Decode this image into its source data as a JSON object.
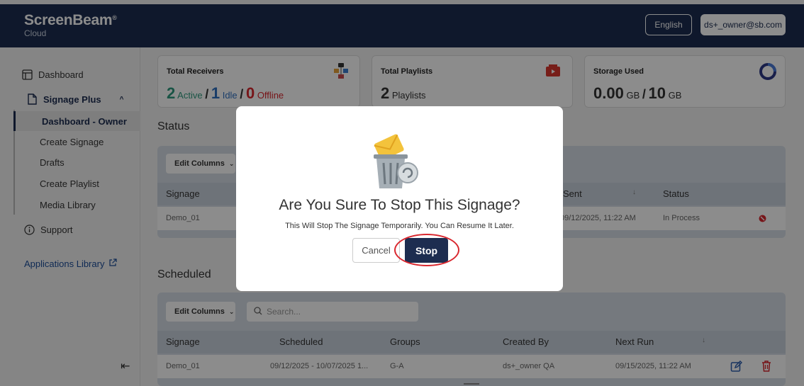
{
  "header": {
    "brand": "ScreenBeam",
    "brand_mark": "®",
    "sub": "Cloud",
    "language": "English",
    "user": "ds+_owner@sb.com"
  },
  "sidebar": {
    "dashboard": "Dashboard",
    "signage_plus": "Signage Plus",
    "items": [
      "Dashboard - Owner",
      "Create Signage",
      "Drafts",
      "Create Playlist",
      "Media Library"
    ],
    "support": "Support",
    "apps_library": "Applications Library",
    "collapse_icon": "arrow-left-bar-icon"
  },
  "cards": {
    "receivers": {
      "title": "Total Receivers",
      "active_count": "2",
      "active_label": "Active",
      "idle_count": "1",
      "idle_label": "Idle",
      "offline_count": "0",
      "offline_label": "Offline",
      "sep": "/"
    },
    "playlists": {
      "title": "Total Playlists",
      "count": "2",
      "label": "Playlists"
    },
    "storage": {
      "title": "Storage Used",
      "used": "0.00",
      "used_unit": "GB",
      "sep": "/",
      "total": "10",
      "total_unit": "GB"
    }
  },
  "status": {
    "title": "Status",
    "edit_columns": "Edit Columns",
    "headers": [
      "Signage",
      "Sent",
      "Status"
    ],
    "row": {
      "signage": "Demo_01",
      "sent": "09/12/2025, 11:22 AM",
      "status": "In Process"
    }
  },
  "scheduled": {
    "title": "Scheduled",
    "edit_columns": "Edit Columns",
    "search_placeholder": "Search...",
    "headers": [
      "Signage",
      "Scheduled",
      "Groups",
      "Created By",
      "Next Run"
    ],
    "row": {
      "signage": "Demo_01",
      "scheduled": "09/12/2025 - 10/07/2025 1...",
      "groups": "G-A",
      "created_by": "ds+_owner QA",
      "next_run": "09/15/2025, 11:22 AM"
    }
  },
  "modal": {
    "title": "Are You Sure To Stop This Signage?",
    "message": "This Will Stop The Signage Temporarily. You Can Resume It Later.",
    "cancel": "Cancel",
    "stop": "Stop"
  },
  "colors": {
    "navy": "#1d2d50",
    "active_green": "#2e9a7e",
    "idle_blue": "#2e6fc0",
    "offline_red": "#d9272e"
  }
}
